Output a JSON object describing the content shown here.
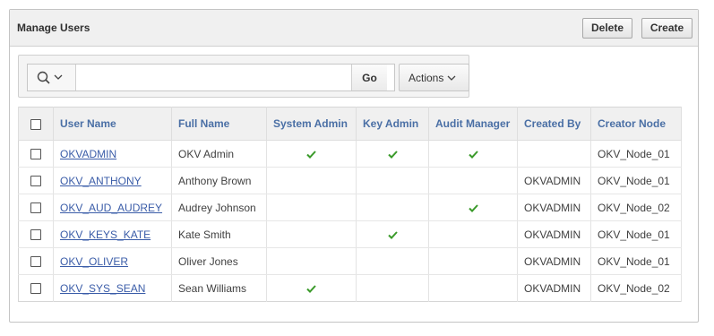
{
  "region": {
    "title": "Manage Users",
    "delete_label": "Delete",
    "create_label": "Create"
  },
  "toolbar": {
    "search_icon": "search-icon",
    "search_value": "",
    "go_label": "Go",
    "actions_label": "Actions"
  },
  "table": {
    "columns": [
      "User Name",
      "Full Name",
      "System Admin",
      "Key Admin",
      "Audit Manager",
      "Created By",
      "Creator Node"
    ],
    "rows": [
      {
        "user": "OKVADMIN",
        "full": "OKV Admin",
        "sys": true,
        "key": true,
        "audit": true,
        "created_by": "",
        "node": "OKV_Node_01"
      },
      {
        "user": "OKV_ANTHONY",
        "full": "Anthony Brown",
        "sys": false,
        "key": false,
        "audit": false,
        "created_by": "OKVADMIN",
        "node": "OKV_Node_01"
      },
      {
        "user": "OKV_AUD_AUDREY",
        "full": "Audrey Johnson",
        "sys": false,
        "key": false,
        "audit": true,
        "created_by": "OKVADMIN",
        "node": "OKV_Node_02"
      },
      {
        "user": "OKV_KEYS_KATE",
        "full": "Kate Smith",
        "sys": false,
        "key": true,
        "audit": false,
        "created_by": "OKVADMIN",
        "node": "OKV_Node_01"
      },
      {
        "user": "OKV_OLIVER",
        "full": "Oliver Jones",
        "sys": false,
        "key": false,
        "audit": false,
        "created_by": "OKVADMIN",
        "node": "OKV_Node_01"
      },
      {
        "user": "OKV_SYS_SEAN",
        "full": "Sean Williams",
        "sys": true,
        "key": false,
        "audit": false,
        "created_by": "OKVADMIN",
        "node": "OKV_Node_02"
      }
    ]
  },
  "colors": {
    "link": "#3a5ca8",
    "header_text": "#4a6fa5",
    "check": "#3a9a2a"
  }
}
